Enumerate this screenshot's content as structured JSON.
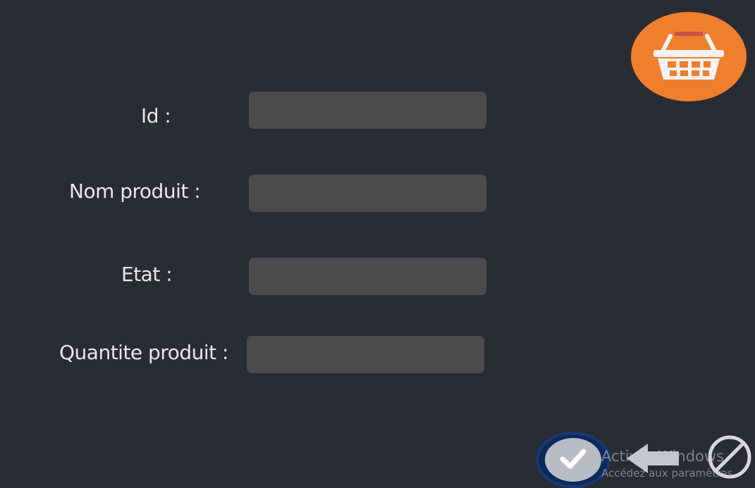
{
  "form": {
    "fields": [
      {
        "label": "Id  :",
        "value": ""
      },
      {
        "label": "Nom produit :",
        "value": ""
      },
      {
        "label": "Etat :",
        "value": ""
      },
      {
        "label": "Quantite produit :",
        "value": ""
      }
    ]
  },
  "actions": {
    "validate_icon": "checkmark-icon",
    "back_icon": "arrow-left-icon",
    "cancel_icon": "prohibited-icon"
  },
  "header": {
    "basket_icon": "shopping-basket-icon"
  },
  "watermark": {
    "title": "Activer Windows",
    "subtitle": "Accédez aux paramètres"
  },
  "colors": {
    "background": "#2a2c33",
    "field_background": "#4b4b4d",
    "label_text": "#e8e8ea",
    "basket_badge": "#f07f2d",
    "validate_ring": "#0e2a5a"
  }
}
